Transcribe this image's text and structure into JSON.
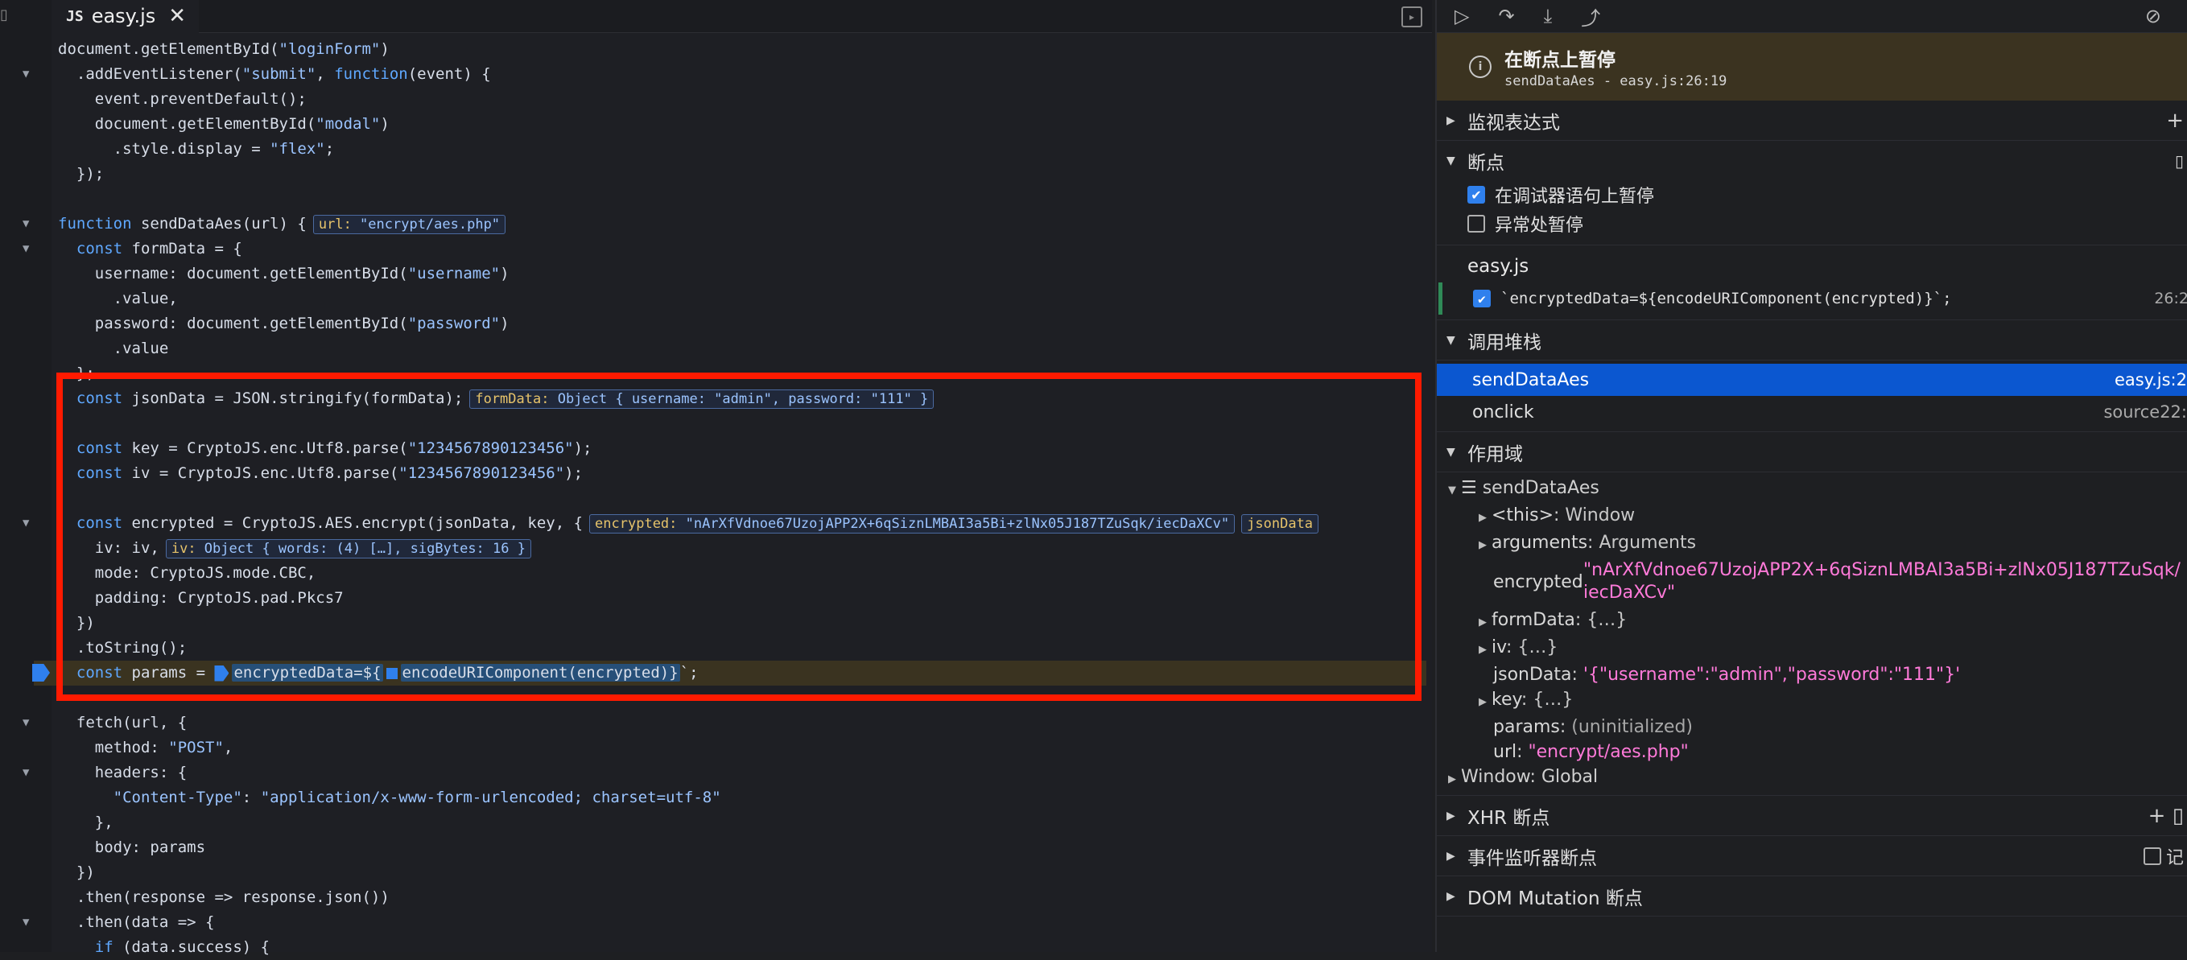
{
  "editor": {
    "tab": {
      "badge": "JS",
      "filename": "easy.js",
      "close": "✕"
    },
    "lines": [
      [
        [
          "fn",
          "document.getElementById("
        ],
        [
          "str",
          "\"loginForm\""
        ],
        [
          "fn",
          ")"
        ]
      ],
      [
        [
          "fn",
          "  .addEventListener("
        ],
        [
          "str",
          "\"submit\""
        ],
        [
          "fn",
          ", "
        ],
        [
          "kw",
          "function"
        ],
        [
          "fn",
          "(event) {"
        ]
      ],
      [
        [
          "fn",
          "    event.preventDefault();"
        ]
      ],
      [
        [
          "fn",
          "    document.getElementById("
        ],
        [
          "str",
          "\"modal\""
        ],
        [
          "fn",
          ")"
        ]
      ],
      [
        [
          "fn",
          "      .style.display = "
        ],
        [
          "str",
          "\"flex\""
        ],
        [
          "fn",
          ";"
        ]
      ],
      [
        [
          "fn",
          "  });"
        ]
      ],
      [],
      [
        [
          "kw",
          "function"
        ],
        [
          "fn",
          " sendDataAes(url) {"
        ]
      ],
      [
        [
          "fn",
          "  "
        ],
        [
          "kw",
          "const"
        ],
        [
          "fn",
          " formData = {"
        ]
      ],
      [
        [
          "fn",
          "    username: document.getElementById("
        ],
        [
          "str",
          "\"username\""
        ],
        [
          "fn",
          ")"
        ]
      ],
      [
        [
          "fn",
          "      .value,"
        ]
      ],
      [
        [
          "fn",
          "    password: document.getElementById("
        ],
        [
          "str",
          "\"password\""
        ],
        [
          "fn",
          ")"
        ]
      ],
      [
        [
          "fn",
          "      .value"
        ]
      ],
      [
        [
          "fn",
          "  };"
        ]
      ],
      [
        [
          "fn",
          "  "
        ],
        [
          "kw",
          "const"
        ],
        [
          "fn",
          " jsonData = JSON.stringify(formData);"
        ]
      ],
      [],
      [
        [
          "fn",
          "  "
        ],
        [
          "kw",
          "const"
        ],
        [
          "fn",
          " key = CryptoJS.enc.Utf8.parse("
        ],
        [
          "str",
          "\"1234567890123456\""
        ],
        [
          "fn",
          ");"
        ]
      ],
      [
        [
          "fn",
          "  "
        ],
        [
          "kw",
          "const"
        ],
        [
          "fn",
          " iv = CryptoJS.enc.Utf8.parse("
        ],
        [
          "str",
          "\"1234567890123456\""
        ],
        [
          "fn",
          ");"
        ]
      ],
      [],
      [
        [
          "fn",
          "  "
        ],
        [
          "kw",
          "const"
        ],
        [
          "fn",
          " encrypted = CryptoJS.AES.encrypt(jsonData, key, {"
        ]
      ],
      [
        [
          "fn",
          "    iv: iv,"
        ]
      ],
      [
        [
          "fn",
          "    mode: CryptoJS.mode.CBC,"
        ]
      ],
      [
        [
          "fn",
          "    padding: CryptoJS.pad.Pkcs7"
        ]
      ],
      [
        [
          "fn",
          "  })"
        ]
      ],
      [
        [
          "fn",
          "  .toString();"
        ]
      ],
      [
        [
          "fn",
          "  "
        ],
        [
          "kw",
          "const"
        ],
        [
          "fn",
          " params = "
        ]
      ],
      [],
      [
        [
          "fn",
          "  fetch(url, {"
        ]
      ],
      [
        [
          "fn",
          "    method: "
        ],
        [
          "str",
          "\"POST\""
        ],
        [
          "fn",
          ","
        ]
      ],
      [
        [
          "fn",
          "    headers: {"
        ]
      ],
      [
        [
          "fn",
          "      "
        ],
        [
          "str",
          "\"Content-Type\""
        ],
        [
          "fn",
          ": "
        ],
        [
          "str",
          "\"application/x-www-form-urlencoded; charset=utf-8\""
        ]
      ],
      [
        [
          "fn",
          "    },"
        ]
      ],
      [
        [
          "fn",
          "    body: params"
        ]
      ],
      [
        [
          "fn",
          "  })"
        ]
      ],
      [
        [
          "fn",
          "  .then(response => response.json())"
        ]
      ],
      [
        [
          "fn",
          "  .then(data => {"
        ]
      ],
      [
        [
          "fn",
          "    "
        ],
        [
          "kw",
          "if"
        ],
        [
          "fn",
          " (data.success) {"
        ]
      ]
    ],
    "folds": [
      1,
      7,
      8,
      19,
      27,
      29,
      35
    ],
    "inline_values": {
      "url": {
        "label": "url:",
        "value": "\"encrypt/aes.php\""
      },
      "formData": {
        "label": "formData:",
        "value": "Object { username: \"admin\", password: \"111\" }"
      },
      "encrypted": {
        "label": "encrypted:",
        "value": "\"nArXfVdnoe67UzojAPP2X+6qSiznLMBAI3a5Bi+zlNx05J187TZuSqk/iecDaXCv\""
      },
      "jsonData_label": "jsonData",
      "iv": {
        "label": "iv:",
        "value": "Object { words: (4) […], sigBytes: 16 }"
      }
    },
    "paused_expr": "encryptedData=${",
    "paused_expr2": "encodeURIComponent(encrypted)}",
    "paused_tail": "`;"
  },
  "debugger": {
    "paused": {
      "title": "在断点上暂停",
      "location": "sendDataAes - easy.js:26:19"
    },
    "sections": {
      "watch": "监视表达式",
      "breakpoints": "断点",
      "callstack": "调用堆栈",
      "scope": "作用域",
      "xhr": "XHR 断点",
      "events": "事件监听器断点",
      "dom": "DOM Mutation 断点"
    },
    "bp_options": [
      {
        "label": "在调试器语句上暂停",
        "checked": true
      },
      {
        "label": "异常处暂停",
        "checked": false
      }
    ],
    "bp_file": "easy.js",
    "bp_item": {
      "code": "`encryptedData=${encodeURIComponent(encrypted)}`;",
      "loc": "26:2"
    },
    "frames": [
      {
        "name": "sendDataAes",
        "loc": "easy.js:2",
        "selected": true
      },
      {
        "name": "onclick",
        "loc": "source22:",
        "selected": false
      }
    ],
    "scope": {
      "header": "☰ sendDataAes",
      "this": {
        "name": "<this>",
        "value": "Window"
      },
      "arguments": {
        "name": "arguments",
        "value": "Arguments"
      },
      "encrypted": {
        "name": "encrypted",
        "value1": "\"nArXfVdnoe67UzojAPP2X+6qSiznLMBAI3a5Bi+zlNx05J187TZuSqk/",
        "value2": "iecDaXCv\""
      },
      "formData": {
        "name": "formData",
        "value": "{…}"
      },
      "iv": {
        "name": "iv",
        "value": "{…}"
      },
      "jsonData": {
        "name": "jsonData",
        "value": "'{\"username\":\"admin\",\"password\":\"111\"}'"
      },
      "key": {
        "name": "key",
        "value": "{…}"
      },
      "params": {
        "name": "params",
        "value": "(uninitialized)"
      },
      "url": {
        "name": "url",
        "value": "\"encrypt/aes.php\""
      },
      "global": "Window: Global"
    },
    "events_cb_label": "记"
  },
  "colors": {
    "accent": "#2f80ed",
    "highlight_box": "#ff1a00",
    "paused_bg": "#3b3320"
  }
}
